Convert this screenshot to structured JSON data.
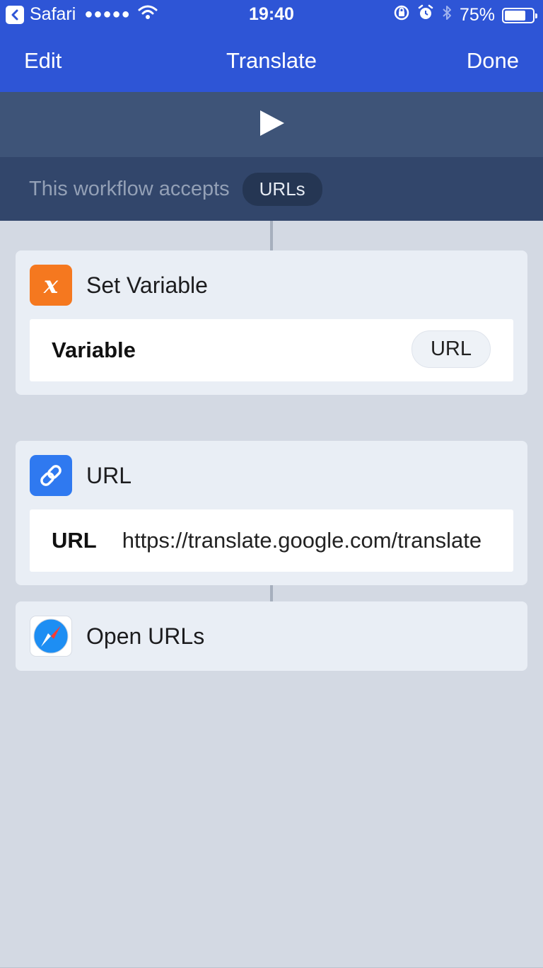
{
  "status_bar": {
    "app": "Safari",
    "signal": "●●●●●",
    "time": "19:40",
    "battery_percent": "75%",
    "battery_level": 0.75
  },
  "nav": {
    "left": "Edit",
    "title": "Translate",
    "right": "Done"
  },
  "accepts": {
    "text": "This workflow accepts",
    "type": "URLs"
  },
  "actions": [
    {
      "title": "Set Variable",
      "icon": "variable-icon",
      "icon_color": "#f5781f",
      "row_label": "Variable",
      "row_value": "URL"
    },
    {
      "title": "URL",
      "icon": "link-icon",
      "icon_color": "#2f79f0",
      "row_label": "URL",
      "row_value": "https://translate.google.com/translate"
    },
    {
      "title": "Open URLs",
      "icon": "safari-compass-icon"
    }
  ],
  "colors": {
    "nav_blue": "#2e55d6",
    "run_bar": "#3e5478",
    "accepts_bar": "#32466b",
    "background": "#d3d9e3"
  }
}
